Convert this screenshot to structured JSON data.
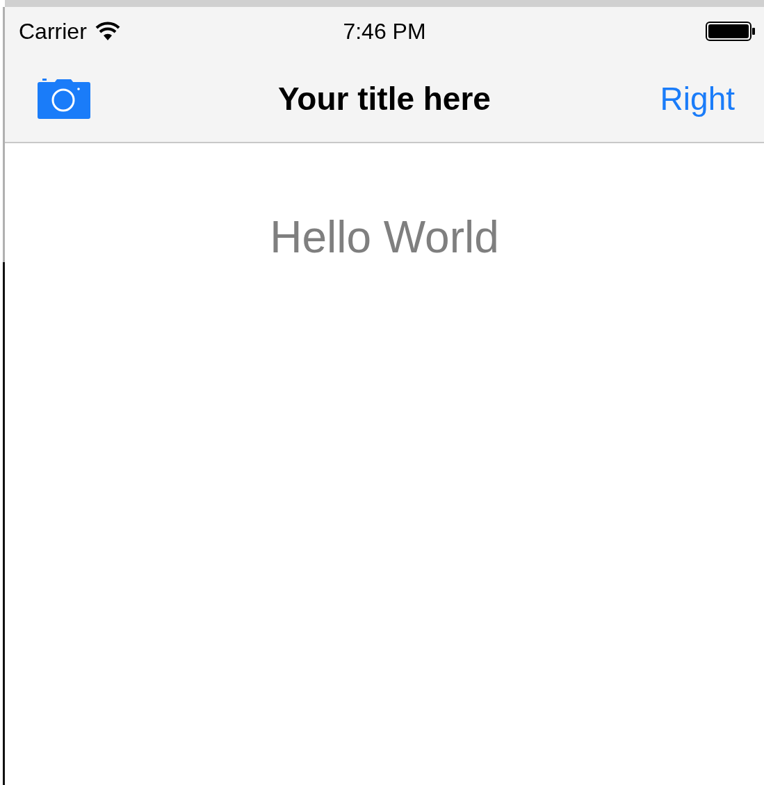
{
  "status_bar": {
    "carrier": "Carrier",
    "time": "7:46 PM"
  },
  "nav_bar": {
    "title": "Your title here",
    "right_button": "Right"
  },
  "content": {
    "label": "Hello World"
  }
}
